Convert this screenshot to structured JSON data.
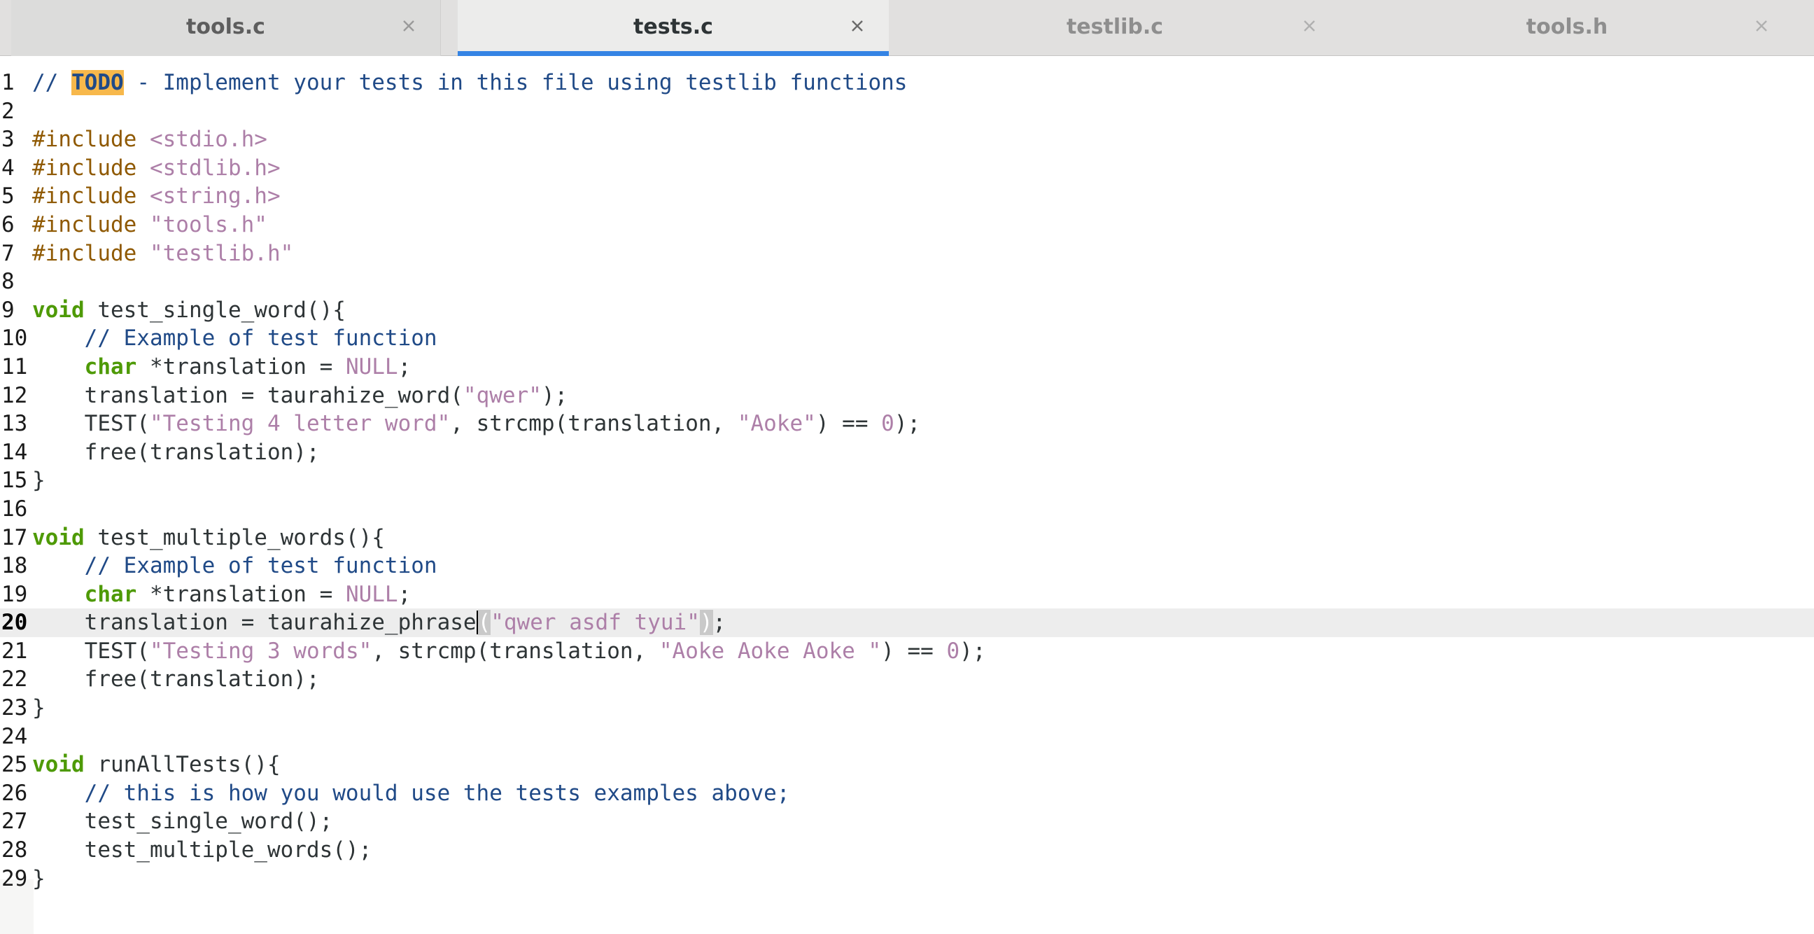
{
  "tabs": [
    {
      "label": "tools.c",
      "close_icon": "close-icon",
      "active": false
    },
    {
      "label": "tests.c",
      "close_icon": "close-icon",
      "active": true
    },
    {
      "label": "testlib.c",
      "close_icon": "close-icon",
      "active": false
    },
    {
      "label": "tools.h",
      "close_icon": "close-icon",
      "active": false
    }
  ],
  "editor": {
    "current_line": 20,
    "colors": {
      "keyword": "#4e9a06",
      "preprocessor": "#8f5902",
      "string": "#ad7fa8",
      "comment": "#204a87",
      "todo_highlight": "#f7b84b",
      "active_tab_underline": "#3584e4"
    },
    "lines": [
      {
        "n": "1",
        "text": "// TODO - Implement your tests in this file using testlib functions"
      },
      {
        "n": "2",
        "text": ""
      },
      {
        "n": "3",
        "text": "#include <stdio.h>"
      },
      {
        "n": "4",
        "text": "#include <stdlib.h>"
      },
      {
        "n": "5",
        "text": "#include <string.h>"
      },
      {
        "n": "6",
        "text": "#include \"tools.h\""
      },
      {
        "n": "7",
        "text": "#include \"testlib.h\""
      },
      {
        "n": "8",
        "text": ""
      },
      {
        "n": "9",
        "text": "void test_single_word(){"
      },
      {
        "n": "10",
        "text": "    // Example of test function"
      },
      {
        "n": "11",
        "text": "    char *translation = NULL;"
      },
      {
        "n": "12",
        "text": "    translation = taurahize_word(\"qwer\");"
      },
      {
        "n": "13",
        "text": "    TEST(\"Testing 4 letter word\", strcmp(translation, \"Aoke\") == 0);"
      },
      {
        "n": "14",
        "text": "    free(translation);"
      },
      {
        "n": "15",
        "text": "}"
      },
      {
        "n": "16",
        "text": ""
      },
      {
        "n": "17",
        "text": "void test_multiple_words(){"
      },
      {
        "n": "18",
        "text": "    // Example of test function"
      },
      {
        "n": "19",
        "text": "    char *translation = NULL;"
      },
      {
        "n": "20",
        "text": "    translation = taurahize_phrase(\"qwer asdf tyui\");"
      },
      {
        "n": "21",
        "text": "    TEST(\"Testing 3 words\", strcmp(translation, \"Aoke Aoke Aoke \") == 0);"
      },
      {
        "n": "22",
        "text": "    free(translation);"
      },
      {
        "n": "23",
        "text": "}"
      },
      {
        "n": "24",
        "text": ""
      },
      {
        "n": "25",
        "text": "void runAllTests(){"
      },
      {
        "n": "26",
        "text": "    // this is how you would use the tests examples above;"
      },
      {
        "n": "27",
        "text": "    test_single_word();"
      },
      {
        "n": "28",
        "text": "    test_multiple_words();"
      },
      {
        "n": "29",
        "text": "}"
      }
    ]
  }
}
